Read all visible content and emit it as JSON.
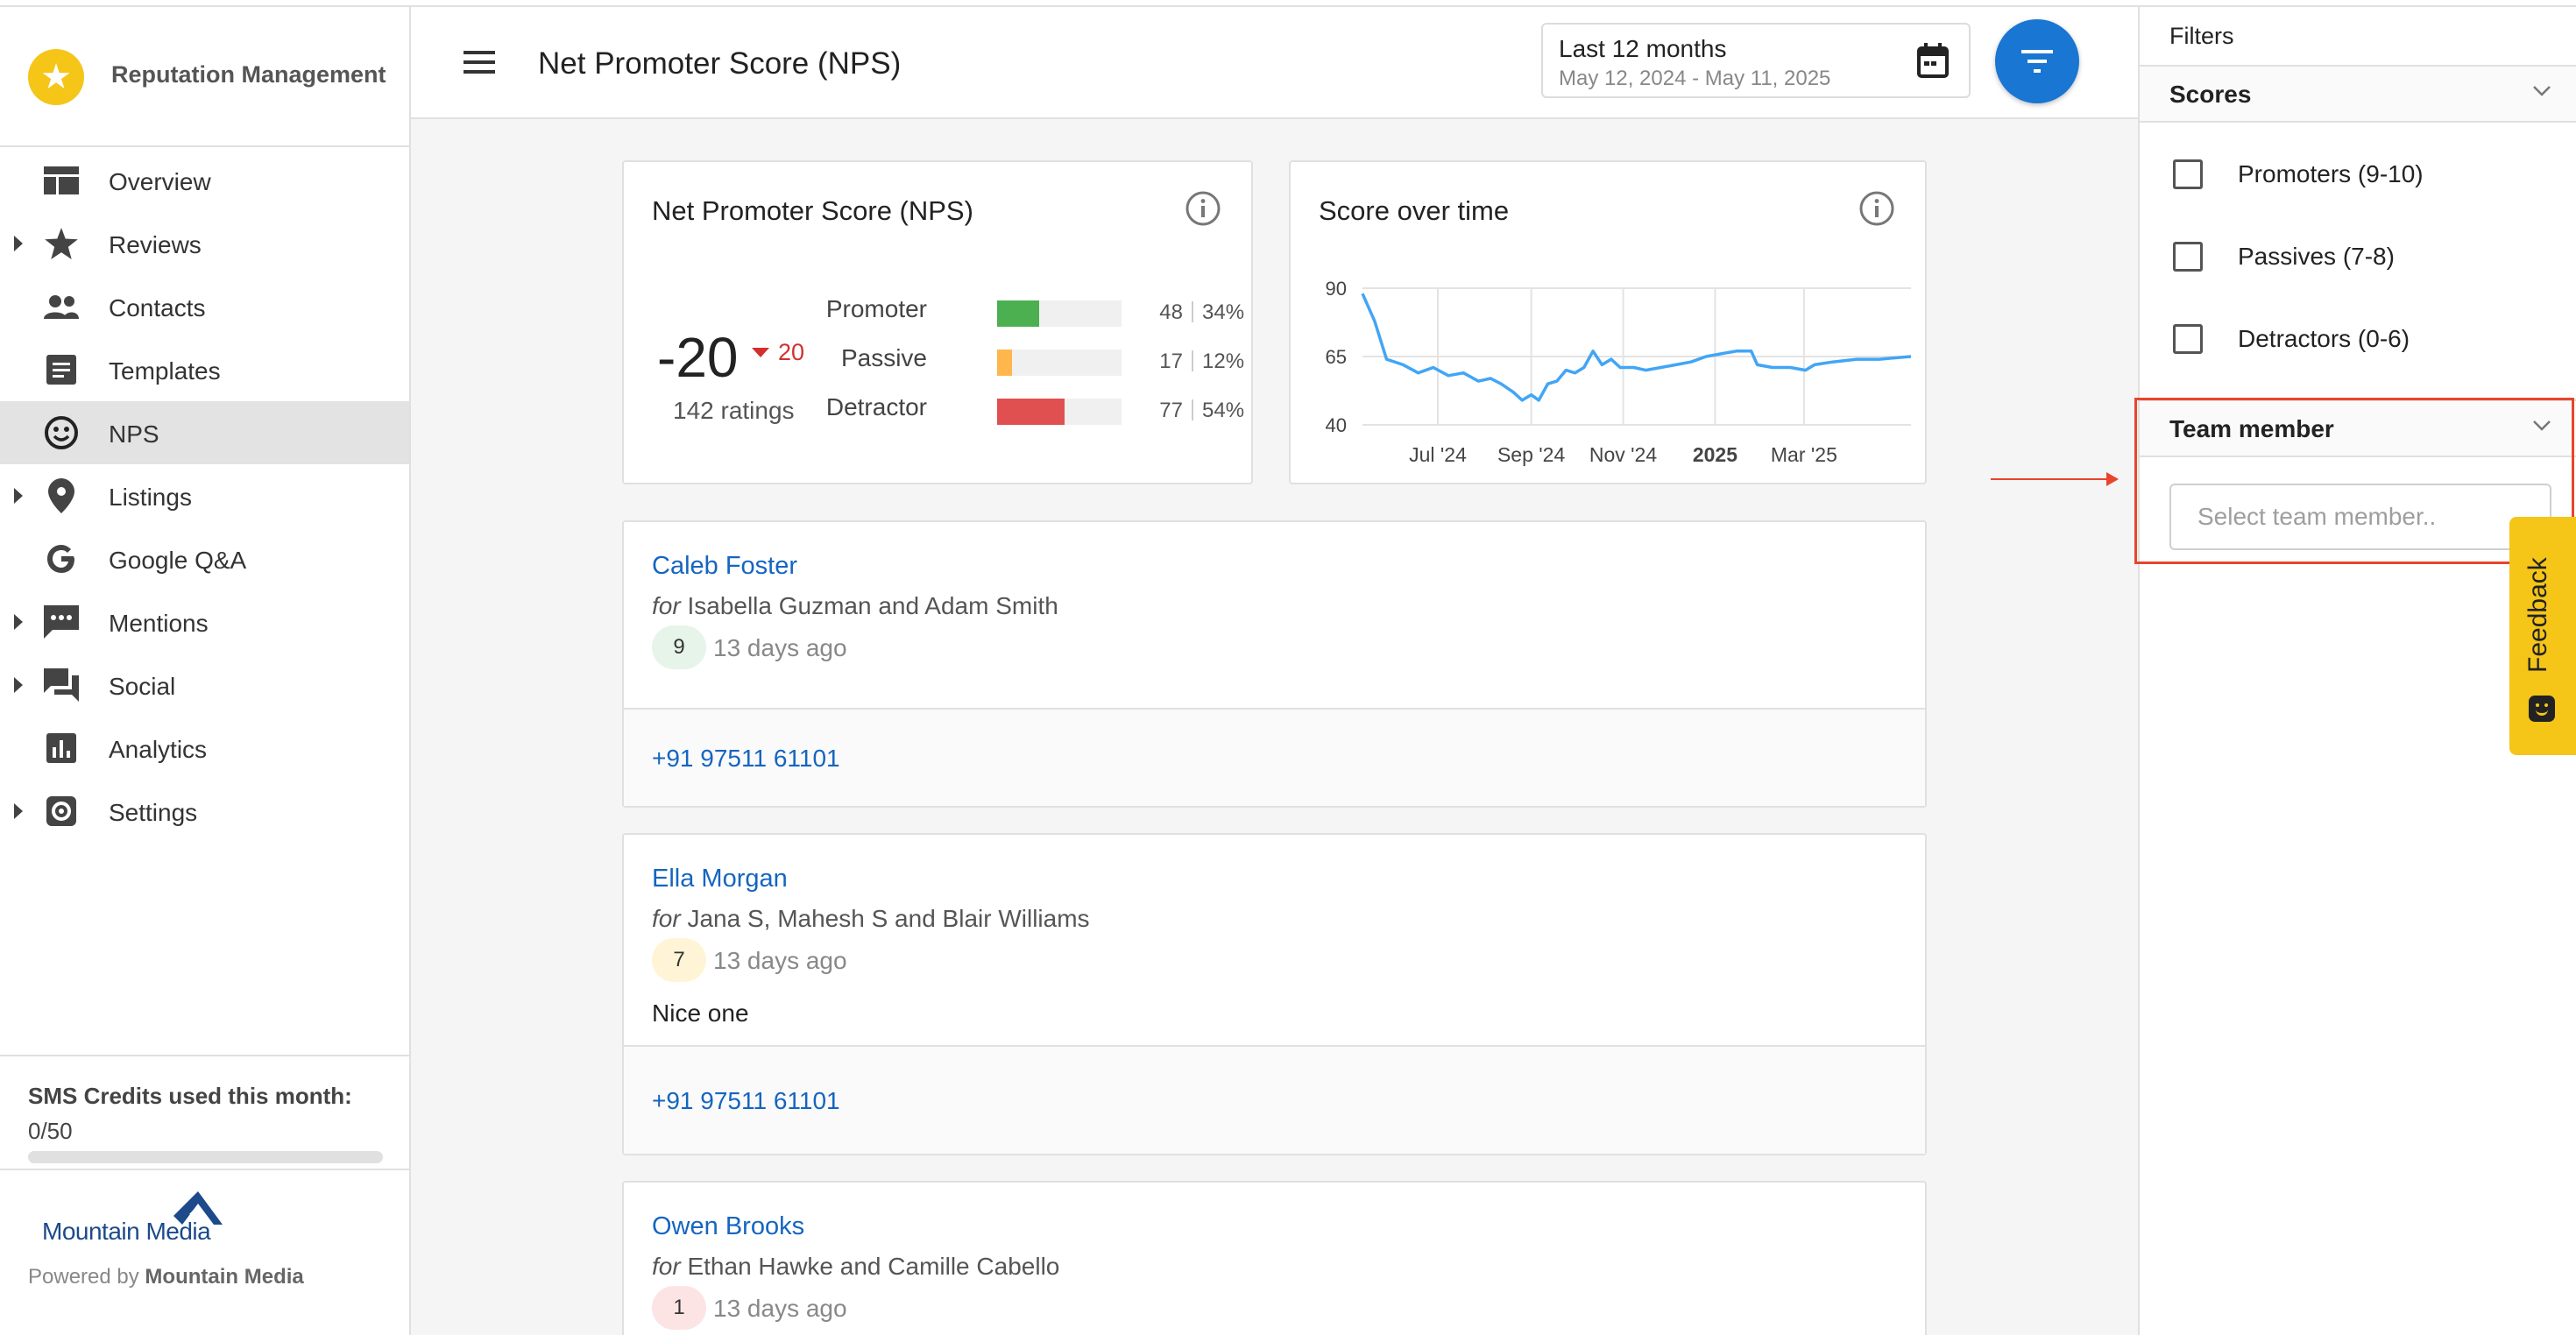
{
  "brand": {
    "name": "Reputation Management"
  },
  "sidebar": {
    "items": [
      {
        "label": "Overview",
        "icon": "dashboard-icon",
        "expandable": false,
        "active": false
      },
      {
        "label": "Reviews",
        "icon": "star-icon",
        "expandable": true,
        "active": false
      },
      {
        "label": "Contacts",
        "icon": "people-icon",
        "expandable": false,
        "active": false
      },
      {
        "label": "Templates",
        "icon": "document-icon",
        "expandable": false,
        "active": false
      },
      {
        "label": "NPS",
        "icon": "smiley-icon",
        "expandable": false,
        "active": true
      },
      {
        "label": "Listings",
        "icon": "location-pin-icon",
        "expandable": true,
        "active": false
      },
      {
        "label": "Google Q&A",
        "icon": "google-icon",
        "expandable": false,
        "active": false
      },
      {
        "label": "Mentions",
        "icon": "chat-bubble-icon",
        "expandable": true,
        "active": false
      },
      {
        "label": "Social",
        "icon": "forum-icon",
        "expandable": true,
        "active": false
      },
      {
        "label": "Analytics",
        "icon": "bar-chart-icon",
        "expandable": false,
        "active": false
      },
      {
        "label": "Settings",
        "icon": "gear-icon",
        "expandable": true,
        "active": false
      }
    ],
    "sms": {
      "title": "SMS Credits used this month:",
      "value": "0/50",
      "used": 0,
      "total": 50
    },
    "footer": {
      "logo_text": "Mountain Media",
      "powered_prefix": "Powered by",
      "powered_name": "Mountain Media"
    }
  },
  "header": {
    "title": "Net Promoter Score (NPS)",
    "date_range": {
      "label": "Last 12 months",
      "range": "May 12, 2024 - May 11, 2025"
    }
  },
  "nps_card": {
    "title": "Net Promoter Score (NPS)",
    "score": "-20",
    "change": "20",
    "ratings": "142 ratings",
    "distribution": [
      {
        "label": "Promoter",
        "count": "48",
        "percent": "34%",
        "fraction": 0.34,
        "color": "#4caf50"
      },
      {
        "label": "Passive",
        "count": "17",
        "percent": "12%",
        "fraction": 0.12,
        "color": "#ffb74d"
      },
      {
        "label": "Detractor",
        "count": "77",
        "percent": "54%",
        "fraction": 0.54,
        "color": "#e05050"
      }
    ]
  },
  "chart_card": {
    "title": "Score over time"
  },
  "chart_data": {
    "type": "line",
    "title": "Score over time",
    "x_tick_labels": [
      "Jul '24",
      "Sep '24",
      "Nov '24",
      "2025",
      "Mar '25"
    ],
    "y_ticks": [
      40,
      65,
      90
    ],
    "ylim": [
      40,
      90
    ],
    "x_range": [
      "2024-05-12",
      "2025-05-11"
    ],
    "grid": true,
    "series": [
      {
        "color": "#42a5f5",
        "points": [
          [
            "2024-05-12",
            88
          ],
          [
            "2024-05-20",
            78
          ],
          [
            "2024-05-28",
            64
          ],
          [
            "2024-06-08",
            62
          ],
          [
            "2024-06-18",
            59
          ],
          [
            "2024-06-28",
            61
          ],
          [
            "2024-07-08",
            58
          ],
          [
            "2024-07-18",
            59
          ],
          [
            "2024-07-28",
            56
          ],
          [
            "2024-08-05",
            57
          ],
          [
            "2024-08-12",
            55
          ],
          [
            "2024-08-20",
            52
          ],
          [
            "2024-08-26",
            49
          ],
          [
            "2024-09-01",
            51
          ],
          [
            "2024-09-06",
            49
          ],
          [
            "2024-09-12",
            55
          ],
          [
            "2024-09-18",
            56
          ],
          [
            "2024-09-24",
            60
          ],
          [
            "2024-09-30",
            59
          ],
          [
            "2024-10-06",
            61
          ],
          [
            "2024-10-12",
            67
          ],
          [
            "2024-10-18",
            62
          ],
          [
            "2024-10-24",
            64
          ],
          [
            "2024-10-30",
            61
          ],
          [
            "2024-11-08",
            61
          ],
          [
            "2024-11-16",
            60
          ],
          [
            "2024-11-26",
            61
          ],
          [
            "2024-12-06",
            62
          ],
          [
            "2024-12-16",
            63
          ],
          [
            "2024-12-26",
            65
          ],
          [
            "2025-01-05",
            66
          ],
          [
            "2025-01-15",
            67
          ],
          [
            "2025-01-25",
            67
          ],
          [
            "2025-01-29",
            62
          ],
          [
            "2025-02-08",
            61
          ],
          [
            "2025-02-20",
            61
          ],
          [
            "2025-03-02",
            60
          ],
          [
            "2025-03-08",
            62
          ],
          [
            "2025-03-20",
            63
          ],
          [
            "2025-04-05",
            64
          ],
          [
            "2025-04-20",
            64
          ],
          [
            "2025-05-11",
            65
          ]
        ]
      }
    ]
  },
  "reviews": [
    {
      "name": "Caleb Foster",
      "for_prefix": "for",
      "for_names": "Isabella Guzman and Adam Smith",
      "score": "9",
      "score_bg": "#e6f4ea",
      "time": "13 days ago",
      "text": "",
      "phone": "+91 97511 61101"
    },
    {
      "name": "Ella Morgan",
      "for_prefix": "for",
      "for_names": "Jana S, Mahesh S and Blair Williams",
      "score": "7",
      "score_bg": "#fff4d6",
      "time": "13 days ago",
      "text": "Nice one",
      "phone": "+91 97511 61101"
    },
    {
      "name": "Owen Brooks",
      "for_prefix": "for",
      "for_names": "Ethan Hawke and Camille Cabello",
      "score": "1",
      "score_bg": "#fde4e4",
      "time": "13 days ago",
      "text": "",
      "phone": ""
    }
  ],
  "filters": {
    "title": "Filters",
    "scores": {
      "label": "Scores",
      "options": [
        "Promoters (9-10)",
        "Passives (7-8)",
        "Detractors (0-6)"
      ]
    },
    "team_member": {
      "label": "Team member",
      "placeholder": "Select team member.."
    }
  },
  "feedback": {
    "label": "Feedback"
  }
}
